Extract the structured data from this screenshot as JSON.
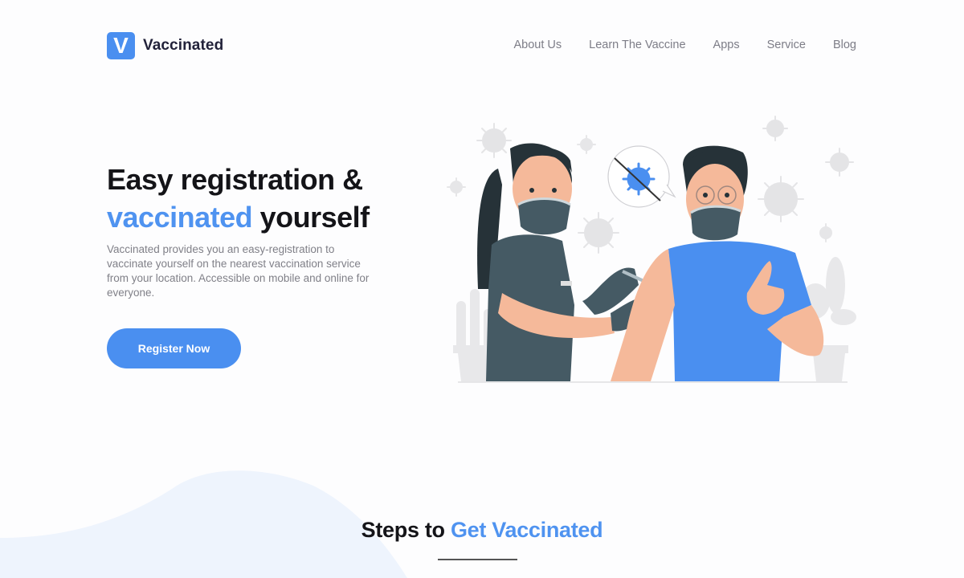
{
  "brand": {
    "logo_letter": "V",
    "name": "Vaccinated",
    "accent_color": "#4a8ff0"
  },
  "nav": {
    "items": [
      {
        "label": "About Us"
      },
      {
        "label": "Learn The Vaccine"
      },
      {
        "label": "Apps"
      },
      {
        "label": "Service"
      },
      {
        "label": "Blog"
      }
    ]
  },
  "hero": {
    "title_line1": "Easy registration &",
    "title_accent": "vaccinated",
    "title_rest": " yourself",
    "description": "Vaccinated provides you an easy-registration to vaccinate yourself on the nearest vaccination service from your location. Accessible on mobile and online for everyone.",
    "cta_label": "Register Now",
    "illustration": "nurse-vaccinating-man-illustration"
  },
  "steps": {
    "title_prefix": "Steps to ",
    "title_accent": "Get Vaccinated"
  }
}
